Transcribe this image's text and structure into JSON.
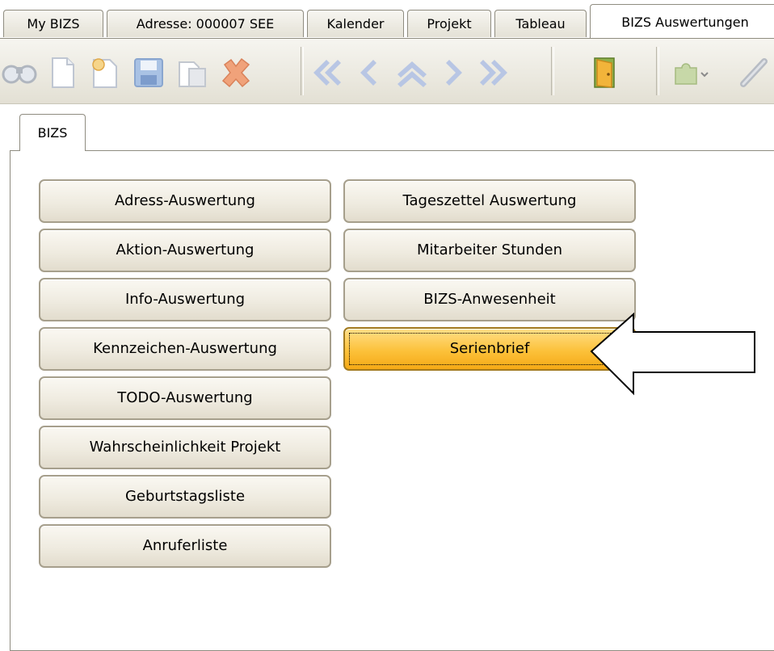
{
  "tabs": [
    {
      "label": "My BIZS"
    },
    {
      "label": "Adresse: 000007 SEE"
    },
    {
      "label": "Kalender"
    },
    {
      "label": "Projekt"
    },
    {
      "label": "Tableau"
    },
    {
      "label": "BIZS Auswertungen"
    }
  ],
  "toolbar": {
    "icons": [
      "binoculars-icon",
      "new-document-icon",
      "new-record-icon",
      "save-icon",
      "copy-icon",
      "delete-icon",
      "first-record-icon",
      "previous-record-icon",
      "up-icon",
      "next-record-icon",
      "last-record-icon",
      "exit-door-icon",
      "plugin-icon",
      "attachment-icon"
    ]
  },
  "panel": {
    "tab_label": "BIZS",
    "left_buttons": [
      "Adress-Auswertung",
      "Aktion-Auswertung",
      "Info-Auswertung",
      "Kennzeichen-Auswertung",
      "TODO-Auswertung",
      "Wahrscheinlichkeit Projekt",
      "Geburtstagsliste",
      "Anruferliste"
    ],
    "right_buttons": [
      "Tageszettel Auswertung",
      "Mitarbeiter Stunden",
      "BIZS-Anwesenheit",
      "Serienbrief"
    ]
  },
  "colors": {
    "highlight": "#fcc13a",
    "button_face": "#efebe0",
    "border": "#a69f8c"
  }
}
